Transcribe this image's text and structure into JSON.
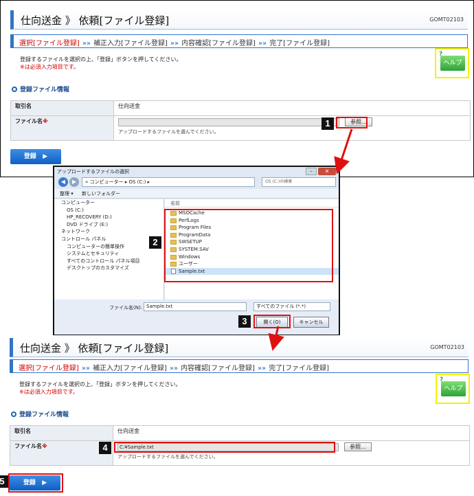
{
  "page": {
    "title": "仕向送金 》 依頼[ファイル登録]",
    "code": "GOMT02103",
    "steps": [
      "選択[ファイル登録]",
      "補正入力[ファイル登録]",
      "内容確認[ファイル登録]",
      "完了[ファイル登録]"
    ],
    "step_sep": "»»",
    "instruction": "登録するファイルを選択の上、「登録」ボタンを押してください。",
    "required_note": "※は必須入力項目です。",
    "help_label": "ヘルプ",
    "help_mark": "?",
    "section_title": "登録ファイル情報",
    "fields": {
      "transaction_label": "取引名",
      "transaction_value": "仕向送金",
      "file_label": "ファイル名",
      "required_mark": "※",
      "browse_label": "参照...",
      "hint": "アップロードするファイルを選んでください。",
      "file_value_after": "C:¥Sample.txt"
    },
    "register_label": "登録",
    "register_arrow": "▶"
  },
  "dialog": {
    "title": "アップロードするファイルの選択",
    "path": "« コンピューター ▸ OS (C:) ▸",
    "search_placeholder": "OS (C:)の検索",
    "toolbar": [
      "整理 ▾",
      "新しいフォルダー"
    ],
    "tree": [
      "コンピューター",
      "OS (C:)",
      "HP_RECOVERY (D:)",
      "DVD ドライブ (E:)",
      "ネットワーク",
      "コントロール パネル",
      "コンピューターの簡単操作",
      "システムとセキュリティ",
      "すべてのコントロール パネル項目",
      "デスクトップのカスタマイズ"
    ],
    "column_header": "名前",
    "files": [
      {
        "name": "MSOCache",
        "type": "folder"
      },
      {
        "name": "PerfLogs",
        "type": "folder"
      },
      {
        "name": "Program Files",
        "type": "folder"
      },
      {
        "name": "ProgramData",
        "type": "folder"
      },
      {
        "name": "SWSETUP",
        "type": "folder"
      },
      {
        "name": "SYSTEM.SAV",
        "type": "folder"
      },
      {
        "name": "Windows",
        "type": "folder"
      },
      {
        "name": "ユーザー",
        "type": "folder"
      },
      {
        "name": "Sample.txt",
        "type": "file"
      }
    ],
    "filename_label": "ファイル名(N):",
    "filename_value": "Sample.txt",
    "filetype_value": "すべてのファイル (*.*)",
    "open_label": "開く(O)",
    "cancel_label": "キャンセル",
    "close_label": "✕",
    "min_label": "–"
  },
  "markers": [
    "1",
    "2",
    "3",
    "4",
    "5"
  ],
  "colors": {
    "accent": "#2f74c8",
    "highlight": "#e01010",
    "help": "#f5f200",
    "current_step": "#cc0000"
  }
}
